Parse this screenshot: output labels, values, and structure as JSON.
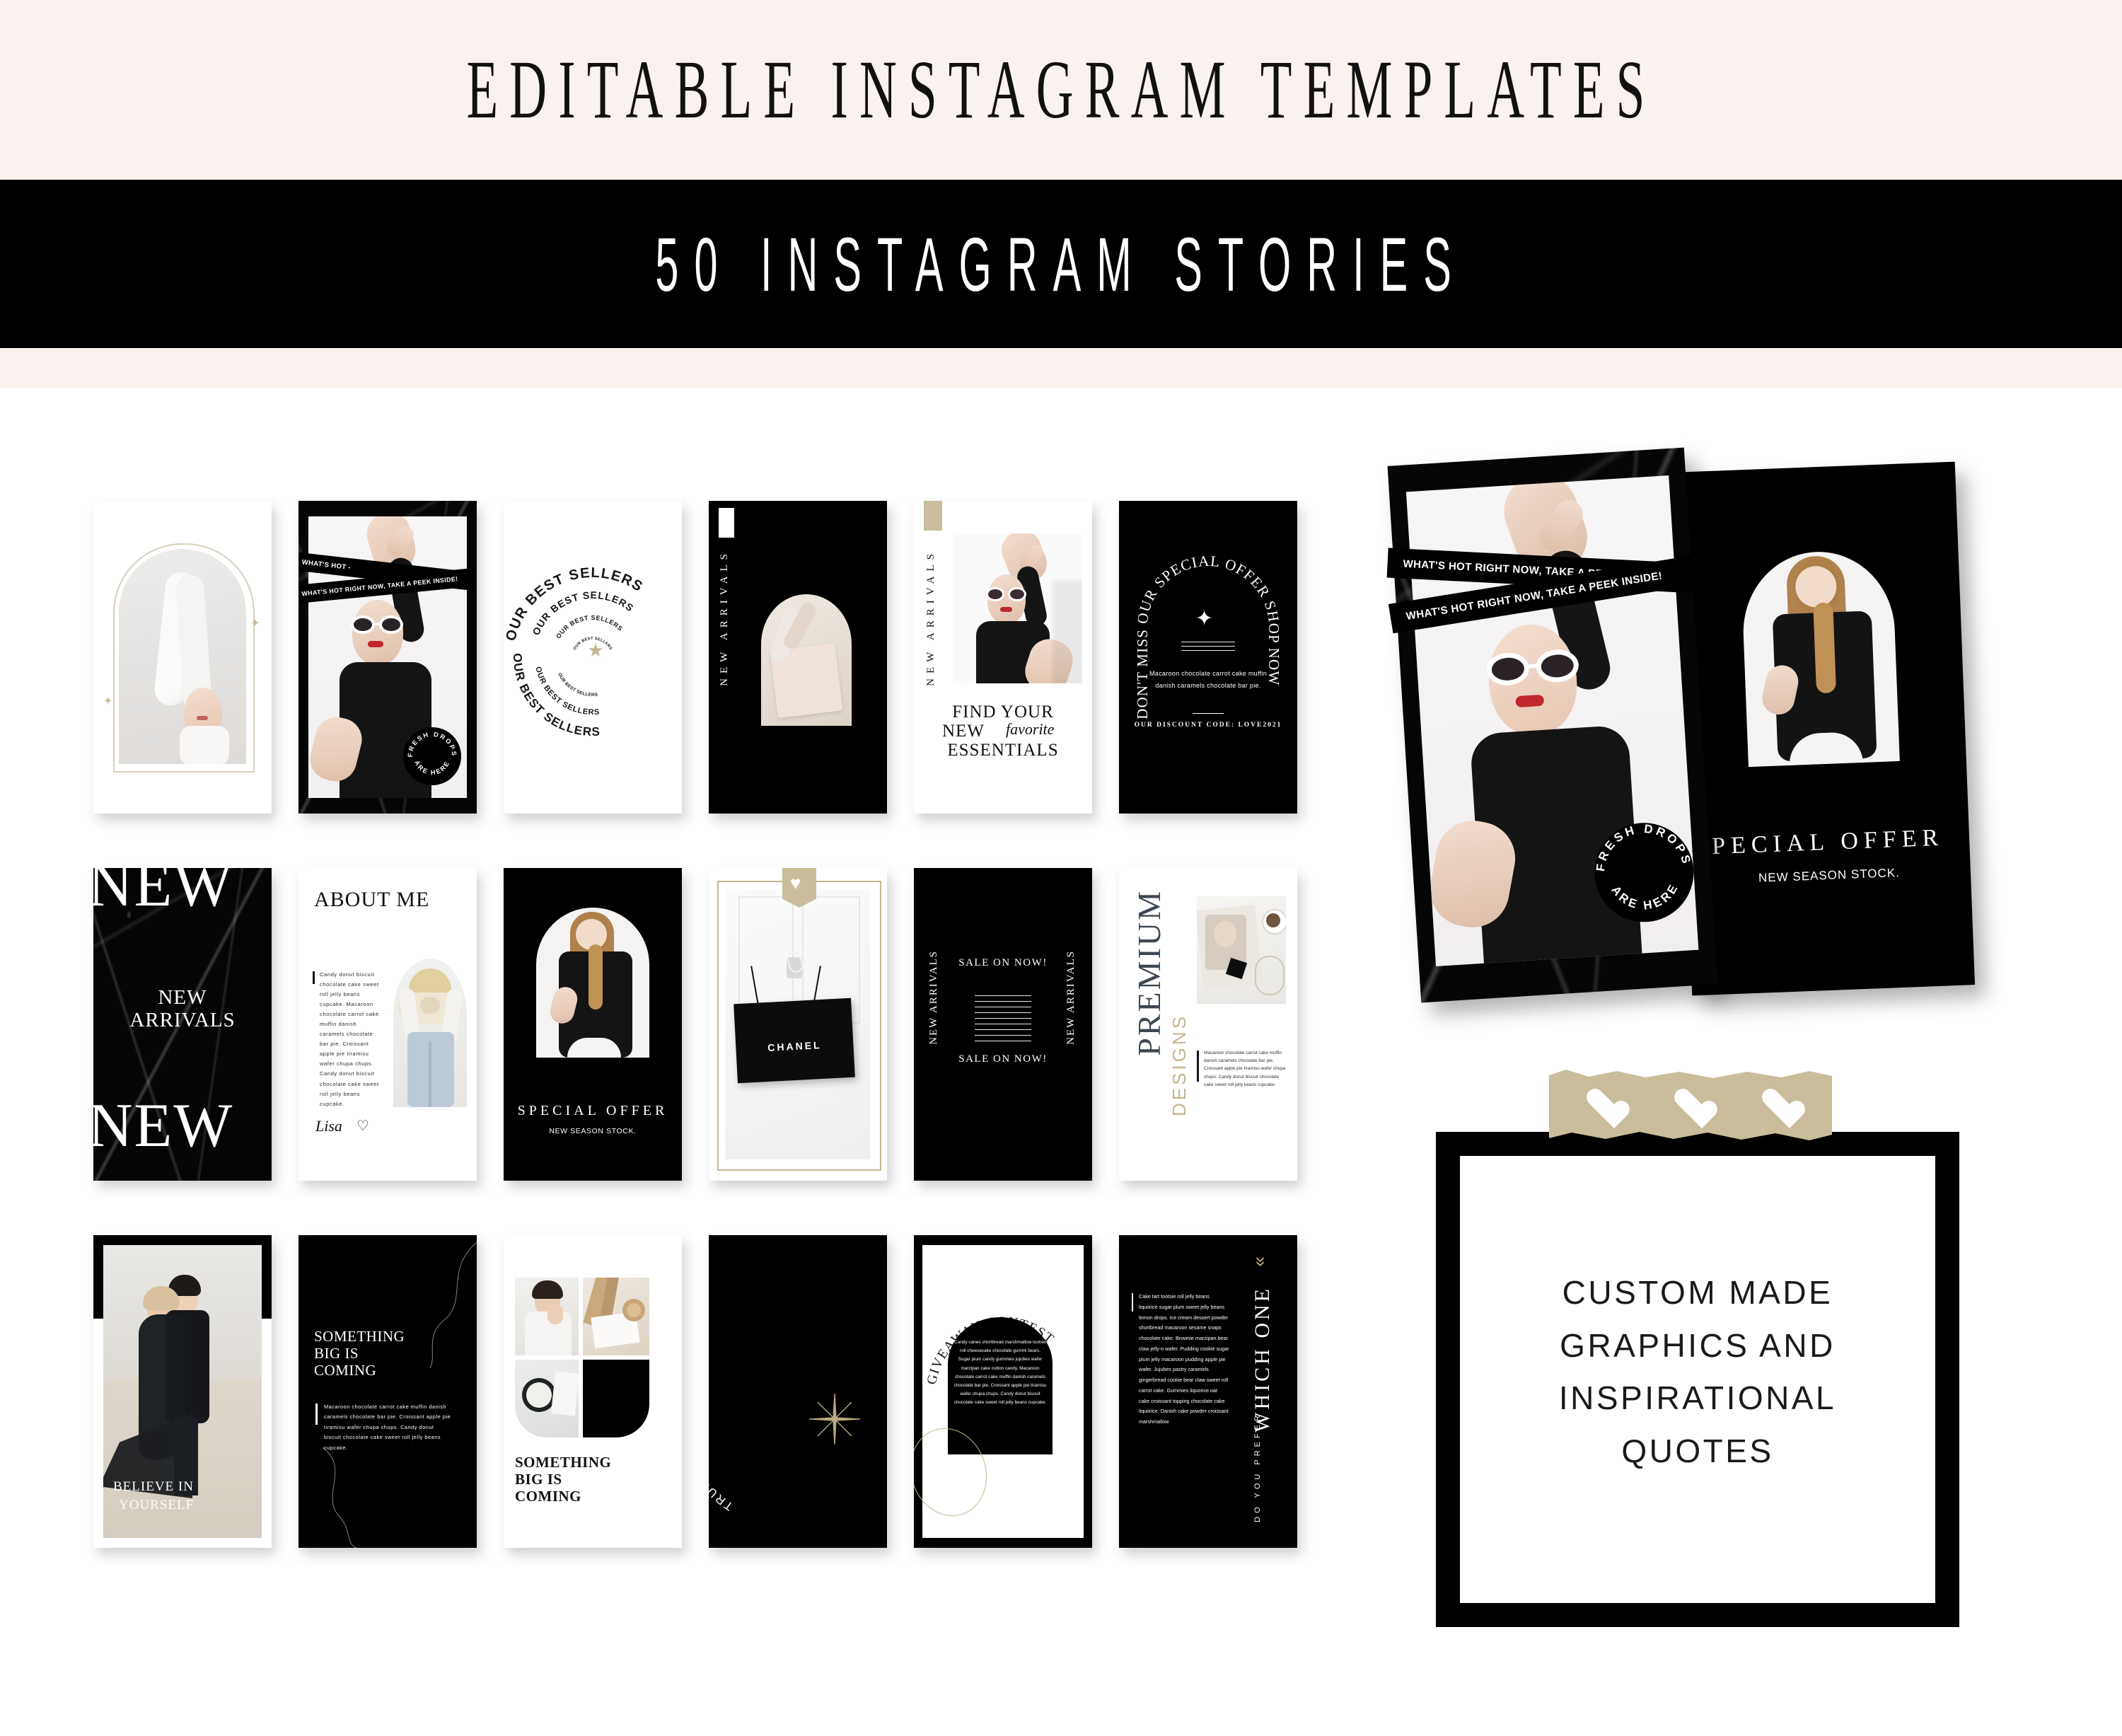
{
  "header": {
    "top_title": "EDITABLE INSTAGRAM TEMPLATES",
    "banner_title": "50 INSTAGRAM STORIES"
  },
  "colors": {
    "cream": "#faf2ee",
    "black": "#000000",
    "gold": "#c9bd9b",
    "white": "#ffffff",
    "slate": "#3d4752"
  },
  "cards": [
    {
      "id": "arch-portrait",
      "name": "arch-portrait-card",
      "style": "white",
      "sparkles": 2
    },
    {
      "id": "whats-hot",
      "name": "whats-hot-marble-card",
      "style": "marble",
      "ribbon_1": "WHAT'S HOT -",
      "ribbon_2": "WHAT'S HOT RIGHT NOW, TAKE A PEEK INSIDE!",
      "ribbon_3": "TAKE A PEEK INSIDE!",
      "badge_top": "FRESH DROPS",
      "badge_bottom": "ARE HERE"
    },
    {
      "id": "best-sellers",
      "name": "best-sellers-spiral-card",
      "style": "white",
      "spiral_text": "OUR BEST SELLERS",
      "star": "★"
    },
    {
      "id": "new-arrivals-book",
      "name": "new-arrivals-book-card",
      "style": "black",
      "label": "NEW ARRIVALS"
    },
    {
      "id": "find-essentials",
      "name": "find-essentials-card",
      "style": "white",
      "label": "NEW ARRIVALS",
      "headline_1": "FIND YOUR",
      "headline_2": "NEW",
      "headline_script": "favorite",
      "headline_3": "ESSENTIALS"
    },
    {
      "id": "special-offer-arch",
      "name": "special-offer-arch-card",
      "style": "black",
      "arc_left": "DON'T MISS",
      "arc_top": "OUR SPECIAL OFFER",
      "arc_right": "SHOP NOW",
      "body": "Macaroon chocolate carrot cake muffin danish caramels chocolate bar pie.",
      "footer": "OUR DISCOUNT CODE: LOVE2021"
    },
    {
      "id": "new-arrivals-marble",
      "name": "new-arrivals-marble-card",
      "style": "marble",
      "big_top": "NEW",
      "center_1": "NEW",
      "center_2": "ARRIVALS",
      "big_bottom": "NEW"
    },
    {
      "id": "about-me",
      "name": "about-me-card",
      "style": "white",
      "title": "ABOUT ME",
      "body": "Candy donut biscuit chocolate cake sweet roll jelly beans cupcake. Macaroon chocolate carrot cake muffin danish caramels chocolate bar pie. Croissant apple pie tiramisu wafer chupa chups. Candy donut biscuit chocolate cake sweet roll jelly beans cupcake.",
      "signature": "Lisa",
      "heart": "♡"
    },
    {
      "id": "special-offer-portrait",
      "name": "special-offer-portrait-card",
      "style": "black",
      "title": "SPECIAL OFFER",
      "subtitle": "NEW SEASON STOCK."
    },
    {
      "id": "chanel-bag",
      "name": "chanel-bag-card",
      "style": "white",
      "bag_label": "CHANEL",
      "tape_heart": "♥"
    },
    {
      "id": "sale-on-now",
      "name": "sale-on-now-card",
      "style": "black",
      "side_left": "NEW ARRIVALS",
      "side_right": "NEW ARRIVALS",
      "top": "SALE ON NOW!",
      "bottom": "SALE ON NOW!"
    },
    {
      "id": "premium-designs",
      "name": "premium-designs-card",
      "style": "white",
      "title": "PREMIUM",
      "subtitle": "DESIGNS",
      "body": "Macaroon chocolate carrot cake muffin danish caramels chocolate bar pie. Croissant apple pie tiramisu wafer chupa chups. Candy donut biscuit chocolate cake sweet roll jelly beans cupcake."
    },
    {
      "id": "believe-in-yourself",
      "name": "believe-in-yourself-card",
      "style": "white",
      "line_1": "BELIEVE IN",
      "line_2": "YOURSELF"
    },
    {
      "id": "something-big-dark",
      "name": "something-big-dark-card",
      "style": "black",
      "line_1": "SOMETHING",
      "line_2": "BIG IS",
      "line_3": "COMING",
      "body": "Macaroon chocolate carrot cake muffin danish caramels chocolate bar pie. Croissant apple pie tiramisu wafer chupa chups. Candy donut biscuit chocolate cake sweet roll jelly beans cupcake."
    },
    {
      "id": "something-big-collage",
      "name": "something-big-collage-card",
      "style": "white",
      "line_1": "SOMETHING",
      "line_2": "BIG IS",
      "line_3": "COMING"
    },
    {
      "id": "trust-your-intuition",
      "name": "trust-your-intuition-card",
      "style": "black",
      "arc_text": "TRUST YOUR INTUITION"
    },
    {
      "id": "giveaway-contest",
      "name": "giveaway-contest-card",
      "style": "black",
      "arc_text": "GIVEAWAY CONTEST",
      "body": "Candy canes shortbread marshmallow tootsie roll cheesecake chocolate gummi bears. Sugar plum candy gummies jujubes wafer marzipan cake cotton candy. Macaroon chocolate carrot cake muffin danish caramels chocolate bar pie. Croissant apple pie tiramisu wafer chupa chups. Candy donut biscuit chocolate cake sweet roll jelly beans cupcake."
    },
    {
      "id": "which-one",
      "name": "which-one-card",
      "style": "black",
      "title": "WHICH ONE",
      "subtitle": "DO YOU PREFER",
      "chevrons": "»",
      "body": "Cake tart tootsie roll jelly beans liquorice sugar plum sweet jelly beans lemon drops. Ice cream dessert powder shortbread macaroon sesame snaps chocolate cake. Brownie marzipan bear claw jelly-o wafer. Pudding cookie sugar plum jelly macaroon pudding apple pie wafer. Jujubes pastry caramels gingerbread cookie bear claw sweet roll carrot cake. Gummies liquorice oat cake croissant topping chocolate cake liquorice. Danish cake powder croissant marshmallow"
    }
  ],
  "mockups": {
    "front": {
      "name": "whats-hot-mockup",
      "ribbon_1": "WHAT'S HOT -",
      "ribbon_2": "WHAT'S HOT RIGHT NOW, TAKE A PEEK INSIDE!",
      "ribbon_3": "TAKE A PEEK INSIDE!",
      "badge_top": "FRESH DROPS",
      "badge_bottom": "ARE HERE"
    },
    "back": {
      "name": "special-offer-mockup",
      "title": "PECIAL OFFER",
      "subtitle": "NEW SEASON STOCK."
    }
  },
  "custom_panel": {
    "name": "custom-made-panel",
    "line_1": "CUSTOM MADE",
    "line_2": "GRAPHICS AND",
    "line_3": "INSPIRATIONAL",
    "line_4": "QUOTES",
    "tape_hearts": [
      "♥",
      "♥",
      "♥"
    ]
  }
}
